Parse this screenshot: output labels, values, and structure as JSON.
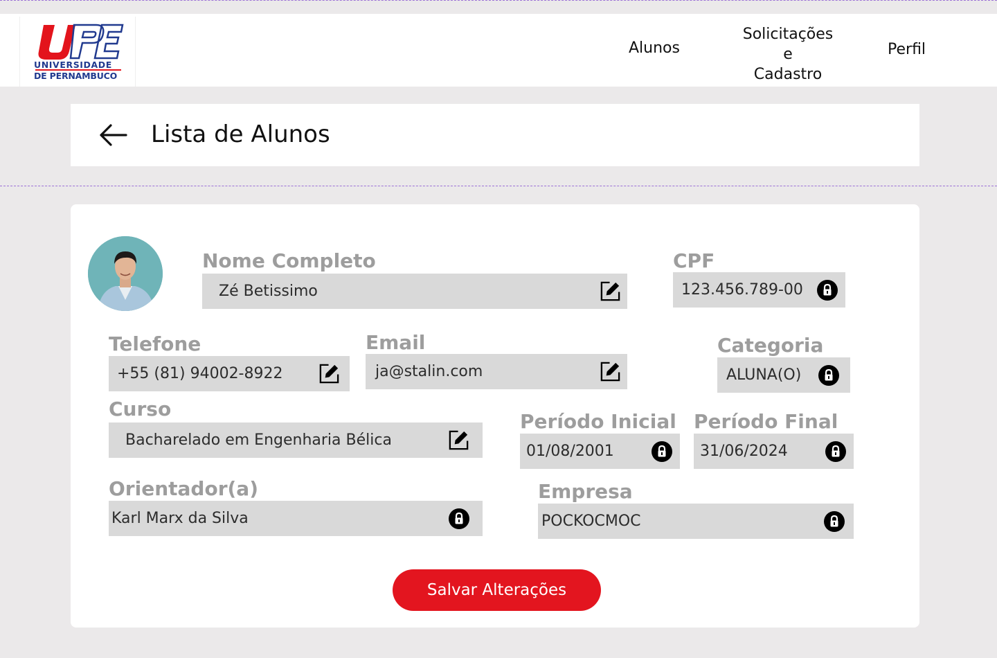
{
  "header": {
    "logo_line1": "UNIVERSIDADE",
    "logo_line2": "DE PERNAMBUCO",
    "logo_letters": "UPE",
    "nav": {
      "alunos": "Alunos",
      "solicitacoes_line1": "Solicitações",
      "solicitacoes_line2": "e",
      "solicitacoes_line3": "Cadastro",
      "perfil": "Perfil"
    }
  },
  "title_bar": {
    "title": "Lista de Alunos",
    "back_icon": "arrow-left-icon"
  },
  "form": {
    "nome": {
      "label": "Nome Completo",
      "value": "Zé Betissimo",
      "icon": "edit-icon"
    },
    "cpf": {
      "label": "CPF",
      "value": "123.456.789-00",
      "icon": "lock-icon"
    },
    "telefone": {
      "label": "Telefone",
      "value": "+55 (81) 94002-8922",
      "icon": "edit-icon"
    },
    "email": {
      "label": "Email",
      "value": "ja@stalin.com",
      "icon": "edit-icon"
    },
    "categoria": {
      "label": "Categoria",
      "value": "ALUNA(O)",
      "icon": "lock-icon"
    },
    "curso": {
      "label": "Curso",
      "value": "Bacharelado em Engenharia Bélica",
      "icon": "edit-icon"
    },
    "periodo_inicial": {
      "label": "Período Inicial",
      "value": "01/08/2001",
      "icon": "lock-icon"
    },
    "periodo_final": {
      "label": "Período Final",
      "value": "31/06/2024",
      "icon": "lock-icon"
    },
    "orientador": {
      "label": "Orientador(a)",
      "value": "Karl Marx da Silva",
      "icon": "lock-icon"
    },
    "empresa": {
      "label": "Empresa",
      "value": "POCKOCMOC",
      "icon": "lock-icon"
    }
  },
  "save_button": "Salvar Alterações",
  "colors": {
    "accent": "#e3151f",
    "brand_blue": "#213a8f",
    "field_bg": "#d9d9d9",
    "label_gray": "#9d9d9d",
    "page_bg": "#ebe9ea"
  }
}
